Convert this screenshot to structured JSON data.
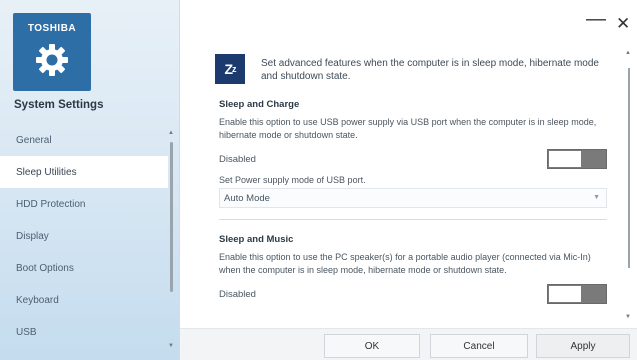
{
  "sidebar": {
    "brand": "TOSHIBA",
    "title": "System Settings",
    "items": [
      {
        "label": "General",
        "active": false
      },
      {
        "label": "Sleep Utilities",
        "active": true
      },
      {
        "label": "HDD Protection",
        "active": false
      },
      {
        "label": "Display",
        "active": false
      },
      {
        "label": "Boot Options",
        "active": false
      },
      {
        "label": "Keyboard",
        "active": false
      },
      {
        "label": "USB",
        "active": false
      }
    ]
  },
  "window": {
    "minimize": "—",
    "close": "✕"
  },
  "header": {
    "icon_text": "Zz",
    "description": "Set advanced features when the computer is in sleep mode, hibernate mode and shutdown state."
  },
  "sleep_and_charge": {
    "title": "Sleep and Charge",
    "description": "Enable this option to use USB power supply via USB port when the computer is in sleep mode, hibernate mode or shutdown state.",
    "status": "Disabled",
    "enabled": false,
    "mode_label": "Set Power supply mode of USB port.",
    "mode_value": "Auto Mode"
  },
  "sleep_and_music": {
    "title": "Sleep and Music",
    "description": "Enable this option to use the PC speaker(s) for a portable audio player (connected via Mic-In) when the computer is in sleep mode, hibernate mode or shutdown state.",
    "status": "Disabled",
    "enabled": false
  },
  "footer": {
    "ok": "OK",
    "cancel": "Cancel",
    "apply": "Apply"
  },
  "colors": {
    "brand_tile": "#2e6ea6",
    "toggle_off": "#7a7a7a",
    "icon_bg": "#1d3a6e"
  }
}
